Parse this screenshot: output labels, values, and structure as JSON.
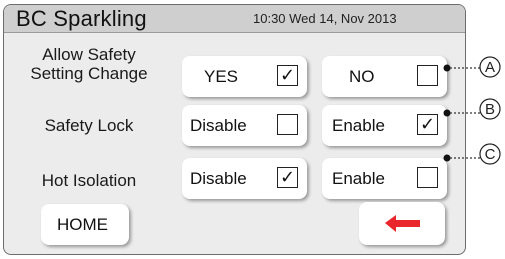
{
  "header": {
    "title": "BC Sparkling",
    "datetime": "10:30 Wed 14, Nov 2013"
  },
  "settings": [
    {
      "label_lines": [
        "Allow Safety",
        "Setting Change"
      ],
      "options": [
        {
          "label": "YES",
          "checked": true
        },
        {
          "label": "NO",
          "checked": false
        }
      ],
      "callout": "A"
    },
    {
      "label_lines": [
        "Safety Lock"
      ],
      "options": [
        {
          "label": "Disable",
          "checked": false
        },
        {
          "label": "Enable",
          "checked": true
        }
      ],
      "callout": "B"
    },
    {
      "label_lines": [
        "Hot Isolation"
      ],
      "options": [
        {
          "label": "Disable",
          "checked": true
        },
        {
          "label": "Enable",
          "checked": false
        }
      ],
      "callout": "C"
    }
  ],
  "check_mark": "✓",
  "footer": {
    "home_label": "HOME",
    "back_icon": "red-left-arrow-icon",
    "back_color": "#e8262b"
  }
}
